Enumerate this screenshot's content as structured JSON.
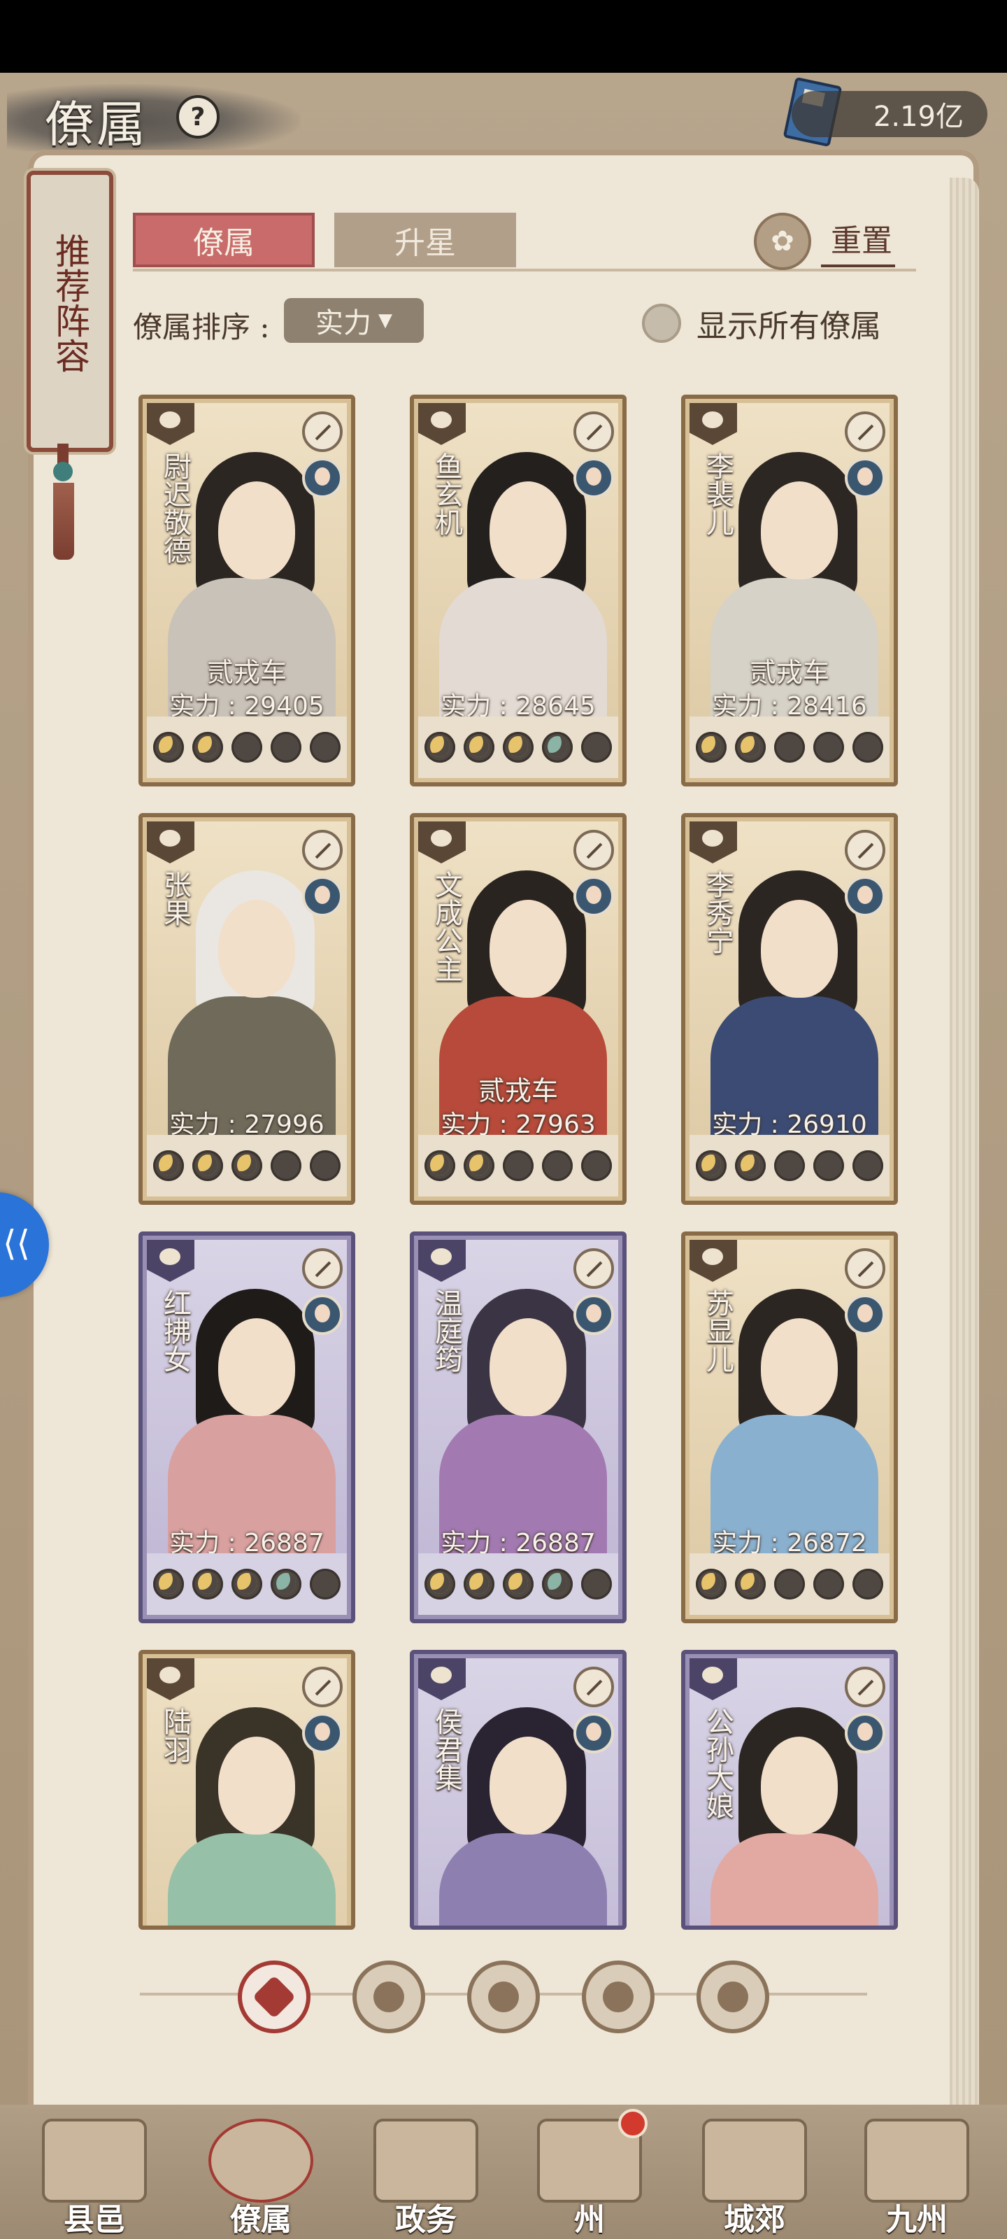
{
  "header": {
    "title": "僚属",
    "help_glyph": "?",
    "currency_value": "2.19亿"
  },
  "side_tag": {
    "label": "推荐阵容"
  },
  "tabs": [
    {
      "label": "僚属",
      "active": true
    },
    {
      "label": "升星",
      "active": false
    }
  ],
  "reset_label": "重置",
  "sort": {
    "label": "僚属排序 :",
    "value": "实力",
    "caret": "▼"
  },
  "show_all_label": "显示所有僚属",
  "cards": [
    {
      "name": "尉迟敬德",
      "mount": "贰戎车",
      "power": "实力 : 29405",
      "frame": "gold",
      "stars": 2,
      "green": 0
    },
    {
      "name": "鱼玄机",
      "mount": "",
      "power": "实力 : 28645",
      "frame": "gold",
      "stars": 3,
      "green": 1
    },
    {
      "name": "李裴儿",
      "mount": "贰戎车",
      "power": "实力 : 28416",
      "frame": "gold",
      "stars": 2,
      "green": 0
    },
    {
      "name": "张果",
      "mount": "",
      "power": "实力 : 27996",
      "frame": "gold",
      "stars": 3,
      "green": 0
    },
    {
      "name": "文成公主",
      "mount": "贰戎车",
      "power": "实力 : 27963",
      "frame": "gold",
      "stars": 2,
      "green": 0
    },
    {
      "name": "李秀宁",
      "mount": "",
      "power": "实力 : 26910",
      "frame": "gold",
      "stars": 2,
      "green": 0
    },
    {
      "name": "红拂女",
      "mount": "",
      "power": "实力 : 26887",
      "frame": "purple",
      "stars": 3,
      "green": 1
    },
    {
      "name": "温庭筠",
      "mount": "",
      "power": "实力 : 26887",
      "frame": "purple",
      "stars": 3,
      "green": 1
    },
    {
      "name": "苏显儿",
      "mount": "",
      "power": "实力 : 26872",
      "frame": "gold",
      "stars": 2,
      "green": 0
    },
    {
      "name": "陆羽",
      "mount": "",
      "power": "",
      "frame": "gold",
      "stars": 0,
      "green": 0
    },
    {
      "name": "侯君集",
      "mount": "",
      "power": "",
      "frame": "purple",
      "stars": 0,
      "green": 0
    },
    {
      "name": "公孙大娘",
      "mount": "",
      "power": "",
      "frame": "purple",
      "stars": 0,
      "green": 0
    }
  ],
  "filters": [
    "all-icon",
    "helmet-icon",
    "horse-icon",
    "fan-icon",
    "tiger-icon"
  ],
  "bottom_nav": [
    {
      "label": "县邑",
      "icon": "county-icon"
    },
    {
      "label": "僚属",
      "icon": "staff-icon",
      "active": true
    },
    {
      "label": "政务",
      "icon": "affairs-icon"
    },
    {
      "label": "州",
      "icon": "state-icon",
      "badge": true
    },
    {
      "label": "城郊",
      "icon": "suburb-icon"
    },
    {
      "label": "九州",
      "icon": "nine-states-icon"
    }
  ]
}
